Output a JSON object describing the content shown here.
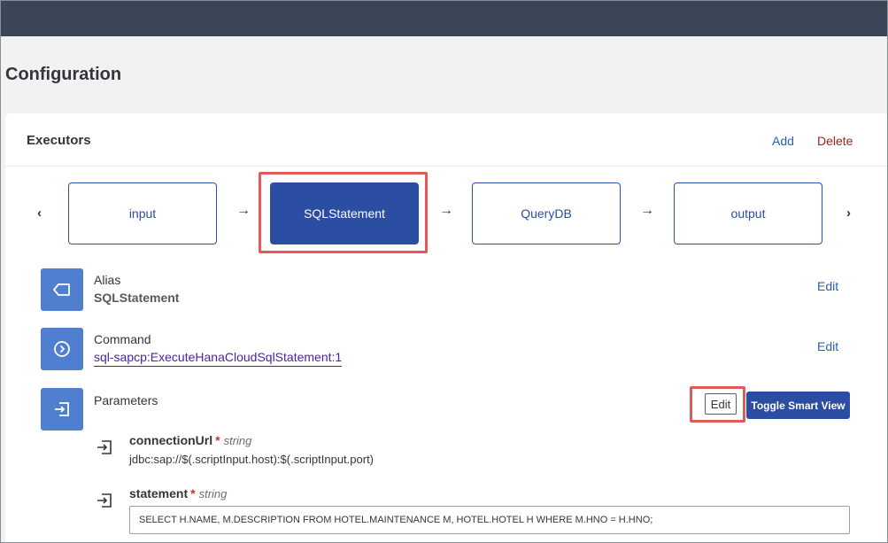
{
  "page": {
    "title": "Configuration"
  },
  "executors": {
    "title": "Executors",
    "add_label": "Add",
    "delete_label": "Delete",
    "steps": [
      {
        "label": "input",
        "active": false
      },
      {
        "label": "SQLStatement",
        "active": true
      },
      {
        "label": "QueryDB",
        "active": false
      },
      {
        "label": "output",
        "active": false
      }
    ],
    "prev_arrow": "‹",
    "next_arrow": "›",
    "connector": "→"
  },
  "details": {
    "alias": {
      "label": "Alias",
      "value": "SQLStatement",
      "edit_label": "Edit"
    },
    "command": {
      "label": "Command",
      "value": "sql-sapcp:ExecuteHanaCloudSqlStatement:1",
      "edit_label": "Edit"
    },
    "parameters": {
      "label": "Parameters",
      "edit_label": "Edit",
      "toggle_label": "Toggle Smart View",
      "items": [
        {
          "name": "connectionUrl",
          "required": "*",
          "type": "string",
          "value": "jdbc:sap://$(.scriptInput.host):$(.scriptInput.port)"
        },
        {
          "name": "statement",
          "required": "*",
          "type": "string",
          "value": "SELECT H.NAME, M.DESCRIPTION FROM HOTEL.MAINTENANCE M, HOTEL.HOTEL H WHERE M.HNO = H.HNO;"
        }
      ]
    }
  },
  "colors": {
    "topbar": "#3a4558",
    "accent": "#2b4ea2",
    "icon_bg": "#4f7fce",
    "highlight": "#e2585b",
    "delete": "#a32020"
  },
  "icons": {
    "alias": "tag-icon",
    "command": "play-circle-icon",
    "parameters": "input-icon"
  }
}
